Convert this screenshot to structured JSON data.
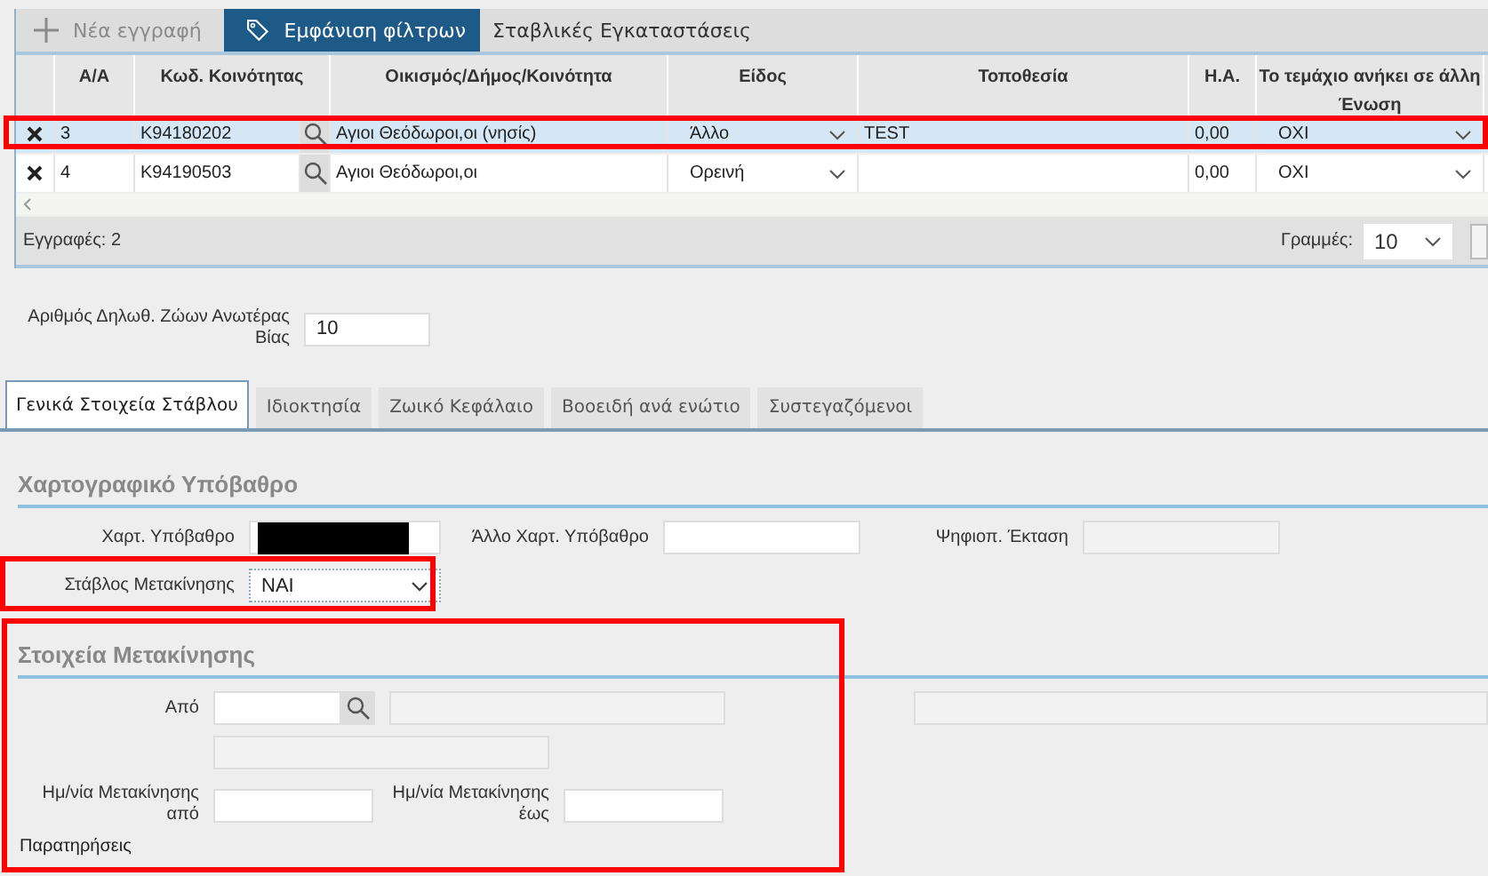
{
  "toolbar": {
    "buttons": [
      {
        "label": "Νέα εγγραφή",
        "kind": "add",
        "disabled": true
      },
      {
        "label": "Εμφάνιση φίλτρων",
        "kind": "filter",
        "disabled": false
      }
    ],
    "title": "Σταβλικές Εγκαταστάσεις"
  },
  "table": {
    "columns": [
      "Α/Α",
      "Κωδ. Κοινότητας",
      "Οικισμός/Δήμος/Κοινότητα",
      "Είδος",
      "Τοποθεσία",
      "Η.Α.",
      "Το τεμάχιο ανήκει σε άλλη Ένωση"
    ],
    "rows": [
      {
        "aa": "3",
        "code": "K94180202",
        "settlement": "Αγιοι Θεόδωροι,οι (νησίς)",
        "type": "Άλλο",
        "location": "TEST",
        "ha": "0,00",
        "other_union": "ΟΧΙ",
        "selected": true
      },
      {
        "aa": "4",
        "code": "K94190503",
        "settlement": "Αγιοι Θεόδωροι,οι",
        "type": "Ορεινή",
        "location": "",
        "ha": "0,00",
        "other_union": "ΟΧΙ",
        "selected": false
      }
    ]
  },
  "footer": {
    "records": "Εγγραφές: 2",
    "rows_label": "Γραμμές:",
    "rows_value": "10"
  },
  "violence_animals": {
    "label": "Αριθμός Δηλωθ. Ζώων Ανωτέρας Βίας",
    "value": "10"
  },
  "tabs": [
    {
      "label": "Γενικά Στοιχεία Στάβλου",
      "selected": true
    },
    {
      "label": "Ιδιοκτησία",
      "selected": false
    },
    {
      "label": "Ζωικό Κεφάλαιο",
      "selected": false
    },
    {
      "label": "Βοοειδή ανά ενώτιο",
      "selected": false
    },
    {
      "label": "Συστεγαζόμενοι",
      "selected": false
    }
  ],
  "map_section": {
    "heading": "Χαρτογραφικό Υπόβαθρο",
    "map_base_label": "Χαρτ. Υπόβαθρο",
    "other_base_label": "Άλλο Χαρτ. Υπόβαθρο",
    "digitized_area_label": "Ψηφιοπ. Έκταση",
    "moving_stable_label": "Στάβλος Μετακίνησης",
    "moving_stable_value": "ΝΑΙ"
  },
  "move_section": {
    "heading": "Στοιχεία Μετακίνησης",
    "from_label": "Από",
    "date_from_label": "Ημ/νία Μετακίνησης από",
    "date_to_label": "Ημ/νία Μετακίνησης έως",
    "notes_label": "Παρατηρήσεις"
  }
}
